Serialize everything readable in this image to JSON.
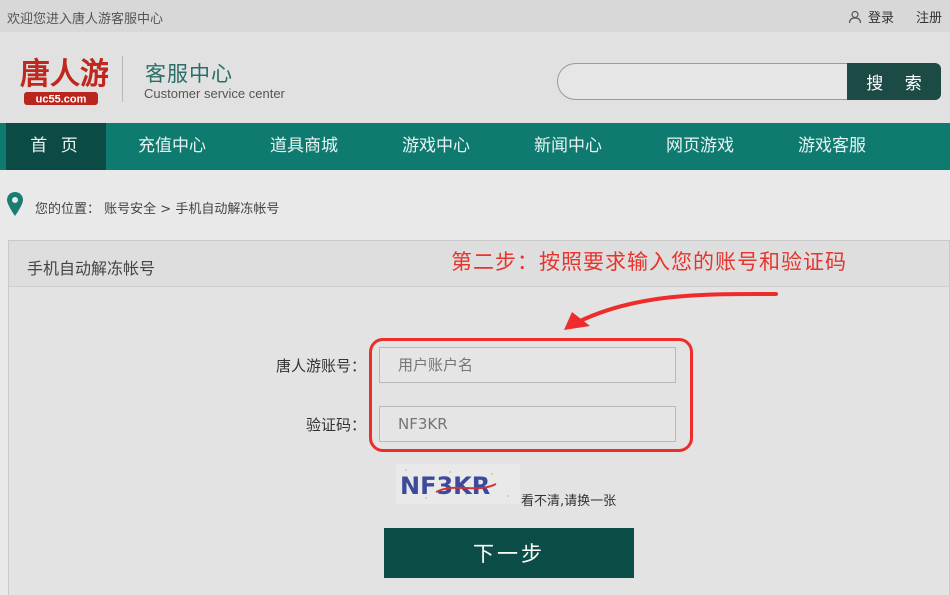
{
  "topbar": {
    "welcome": "欢迎您进入唐人游客服中心",
    "login": "登录",
    "register": "注册"
  },
  "header": {
    "logo_text": "唐人游",
    "logo_domain": "uc55.com",
    "title": "客服中心",
    "subtitle": "Customer service center",
    "search_placeholder": "",
    "search_button": "搜 索"
  },
  "nav": {
    "items": [
      {
        "label": "首 页"
      },
      {
        "label": "充值中心"
      },
      {
        "label": "道具商城"
      },
      {
        "label": "游戏中心"
      },
      {
        "label": "新闻中心"
      },
      {
        "label": "网页游戏"
      },
      {
        "label": "游戏客服"
      }
    ]
  },
  "breadcrumb": {
    "prefix": "您的位置：",
    "path": "账号安全 > 手机自动解冻帐号"
  },
  "panel": {
    "title": "手机自动解冻帐号",
    "instruction": "第二步：按照要求输入您的账号和验证码"
  },
  "form": {
    "account_label": "唐人游账号：",
    "account_placeholder": "用户账户名",
    "captcha_label": "验证码：",
    "captcha_placeholder": "NF3KR",
    "captcha_image_text": "NF3KR",
    "refresh_text": "看不清,请换一张",
    "next_button": "下一步"
  },
  "colors": {
    "nav_bg": "#0f7a70",
    "nav_active": "#0b4a45",
    "button_dark": "#0c4e47",
    "annotation_red": "#ee2c2c"
  }
}
